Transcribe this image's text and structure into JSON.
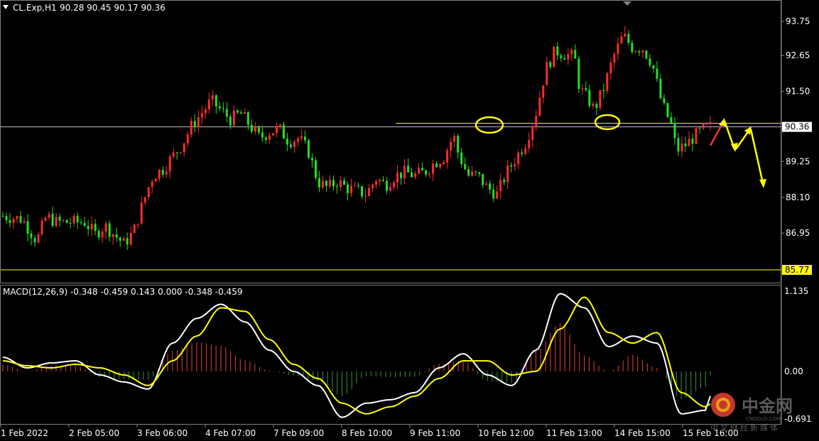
{
  "header": {
    "symbol_label": "CL.Exp,H1",
    "ohlc": "90.28 90.45 90.17 90.36"
  },
  "macd": {
    "label": "MACD(12,26,9) -0.348 -0.459 0.143 0.000 -0.348 -0.459"
  },
  "watermark": {
    "brand_cn": "中金网",
    "brand_en": "CNGOLD.COM",
    "tagline": "中文财经新媒体"
  },
  "colors": {
    "bull": "#ff2b2b",
    "bear": "#22e022",
    "price_line": "#c0c0c0",
    "annotation": "#ffff00",
    "macd_main": "#ffffff",
    "macd_signal": "#ffff00",
    "hist_pos": "#c0392b",
    "hist_neg": "#2e7d32",
    "grid": "#808080"
  },
  "chart_data": [
    {
      "type": "candlestick",
      "title": "CL.Exp,H1",
      "current_price": "90.36",
      "support_level": "85.77",
      "resistance_level": 90.36,
      "y_ticks": [
        "93.75",
        "92.65",
        "91.50",
        "90.36",
        "89.25",
        "88.10",
        "86.95",
        "85.77"
      ],
      "ylim": [
        85.5,
        94.0
      ],
      "x_ticks": [
        "1 Feb 2022",
        "2 Feb 05:00",
        "3 Feb 06:00",
        "4 Feb 07:00",
        "7 Feb 09:00",
        "8 Feb 10:00",
        "9 Feb 11:00",
        "10 Feb 12:00",
        "11 Feb 13:00",
        "14 Feb 15:00",
        "15 Feb 16:00"
      ],
      "close_path": [
        [
          0,
          87.5
        ],
        [
          4,
          87.4
        ],
        [
          7,
          86.7
        ],
        [
          9,
          87.5
        ],
        [
          11,
          87.3
        ],
        [
          13,
          87.3
        ],
        [
          15,
          87.3
        ],
        [
          17,
          87.3
        ],
        [
          19,
          86.9
        ],
        [
          21,
          87.2
        ],
        [
          23,
          86.9
        ],
        [
          25,
          86.6
        ],
        [
          27,
          87.0
        ],
        [
          28,
          87.5
        ],
        [
          30,
          88.4
        ],
        [
          31,
          88.8
        ],
        [
          33,
          89.0
        ],
        [
          35,
          89.4
        ],
        [
          37,
          89.8
        ],
        [
          39,
          90.4
        ],
        [
          41,
          90.8
        ],
        [
          43,
          91.2
        ],
        [
          45,
          90.9
        ],
        [
          47,
          90.6
        ],
        [
          49,
          90.8
        ],
        [
          51,
          90.4
        ],
        [
          53,
          90.0
        ],
        [
          55,
          90.2
        ],
        [
          57,
          90.3
        ],
        [
          59,
          89.9
        ],
        [
          61,
          90.0
        ],
        [
          63,
          89.6
        ],
        [
          65,
          88.6
        ],
        [
          67,
          88.4
        ],
        [
          69,
          88.6
        ],
        [
          71,
          88.4
        ],
        [
          73,
          88.3
        ],
        [
          75,
          88.2
        ],
        [
          77,
          88.7
        ],
        [
          79,
          88.5
        ],
        [
          81,
          88.8
        ],
        [
          83,
          88.9
        ],
        [
          85,
          88.8
        ],
        [
          87,
          88.9
        ],
        [
          89,
          89.2
        ],
        [
          91,
          89.4
        ],
        [
          93,
          90.1
        ],
        [
          94,
          89.5
        ],
        [
          96,
          88.8
        ],
        [
          98,
          88.8
        ],
        [
          100,
          88.4
        ],
        [
          102,
          88.2
        ],
        [
          104,
          88.9
        ],
        [
          106,
          89.4
        ],
        [
          108,
          89.9
        ],
        [
          110,
          90.8
        ],
        [
          112,
          92.2
        ],
        [
          114,
          92.8
        ],
        [
          116,
          92.7
        ],
        [
          118,
          92.6
        ],
        [
          119,
          91.6
        ],
        [
          121,
          91.2
        ],
        [
          122,
          90.9
        ],
        [
          124,
          91.6
        ],
        [
          126,
          92.6
        ],
        [
          128,
          93.3
        ],
        [
          130,
          92.9
        ],
        [
          132,
          92.9
        ],
        [
          134,
          92.4
        ],
        [
          136,
          91.1
        ],
        [
          138,
          90.4
        ],
        [
          139,
          89.6
        ],
        [
          141,
          89.8
        ],
        [
          143,
          90.1
        ],
        [
          145,
          90.3
        ],
        [
          146,
          90.36
        ]
      ],
      "forecast_arrows": [
        "up",
        "down",
        "up",
        "down"
      ]
    },
    {
      "type": "macd",
      "parameters": [
        12,
        26,
        9
      ],
      "values": {
        "macd": -0.348,
        "signal": -0.459,
        "histogram": 0.143
      },
      "y_ticks": [
        "1.135",
        "0.00",
        "-0.691"
      ],
      "ylim": [
        -0.8,
        1.2
      ],
      "macd_path": [
        [
          0,
          0.2
        ],
        [
          5,
          0.05
        ],
        [
          10,
          0.12
        ],
        [
          15,
          0.15
        ],
        [
          20,
          -0.05
        ],
        [
          25,
          -0.15
        ],
        [
          30,
          -0.25
        ],
        [
          35,
          0.4
        ],
        [
          40,
          0.75
        ],
        [
          45,
          0.95
        ],
        [
          50,
          0.7
        ],
        [
          55,
          0.3
        ],
        [
          60,
          0.0
        ],
        [
          65,
          -0.2
        ],
        [
          70,
          -0.65
        ],
        [
          75,
          -0.45
        ],
        [
          80,
          -0.4
        ],
        [
          85,
          -0.3
        ],
        [
          90,
          0.05
        ],
        [
          95,
          0.25
        ],
        [
          100,
          -0.05
        ],
        [
          105,
          -0.2
        ],
        [
          110,
          0.3
        ],
        [
          115,
          1.1
        ],
        [
          120,
          0.9
        ],
        [
          125,
          0.35
        ],
        [
          130,
          0.5
        ],
        [
          135,
          0.4
        ],
        [
          140,
          -0.6
        ],
        [
          145,
          -0.55
        ],
        [
          146,
          -0.348
        ]
      ],
      "signal_path": [
        [
          0,
          0.15
        ],
        [
          5,
          0.08
        ],
        [
          10,
          0.05
        ],
        [
          15,
          0.1
        ],
        [
          20,
          0.05
        ],
        [
          25,
          -0.05
        ],
        [
          30,
          -0.2
        ],
        [
          35,
          0.15
        ],
        [
          40,
          0.5
        ],
        [
          45,
          0.9
        ],
        [
          50,
          0.85
        ],
        [
          55,
          0.45
        ],
        [
          60,
          0.1
        ],
        [
          65,
          -0.1
        ],
        [
          70,
          -0.45
        ],
        [
          75,
          -0.6
        ],
        [
          80,
          -0.5
        ],
        [
          85,
          -0.35
        ],
        [
          90,
          -0.1
        ],
        [
          95,
          0.15
        ],
        [
          100,
          0.15
        ],
        [
          105,
          -0.05
        ],
        [
          110,
          0.0
        ],
        [
          115,
          0.6
        ],
        [
          120,
          1.05
        ],
        [
          125,
          0.55
        ],
        [
          130,
          0.4
        ],
        [
          135,
          0.55
        ],
        [
          140,
          -0.3
        ],
        [
          145,
          -0.5
        ],
        [
          146,
          -0.459
        ]
      ]
    }
  ]
}
